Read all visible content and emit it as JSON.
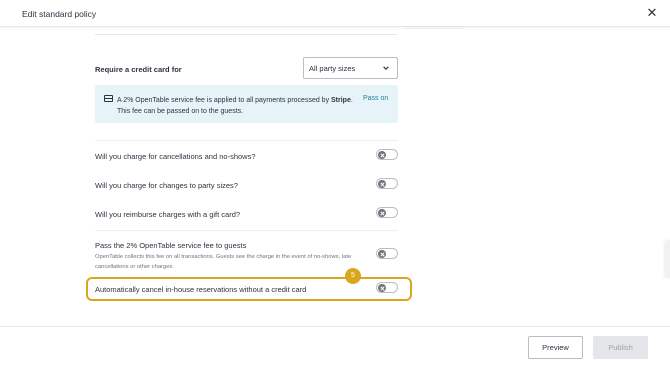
{
  "header": {
    "title": "Edit standard policy",
    "close_icon": "close-icon"
  },
  "credit_card": {
    "label": "Require a credit card for",
    "select_value": "All party sizes"
  },
  "info_box": {
    "icon": "credit-card-icon",
    "text_before": "A 2% OpenTable service fee is applied to all payments processed by ",
    "text_bold": "Stripe",
    "text_after": ". This fee can be passed on to the guests.",
    "link": "Pass on"
  },
  "questions": [
    {
      "label": "Will you charge for cancellations and no-shows?",
      "enabled": false
    },
    {
      "label": "Will you charge for changes to party sizes?",
      "enabled": false
    },
    {
      "label": "Will you reimburse charges with a gift card?",
      "enabled": false
    }
  ],
  "pass_fee": {
    "label": "Pass the 2% OpenTable service fee to guests",
    "description": "OpenTable collects this fee on all transactions. Guests see the charge in the event of no-shows, late cancellations or other charges.",
    "enabled": false
  },
  "auto_cancel": {
    "label": "Automatically cancel in-house reservations without a credit card",
    "enabled": false,
    "step_badge": "5"
  },
  "footer": {
    "preview_label": "Preview",
    "publish_label": "Publish"
  },
  "colors": {
    "highlight": "#d8a71f",
    "link": "#247f9e",
    "info_bg": "#e6f3f8"
  }
}
